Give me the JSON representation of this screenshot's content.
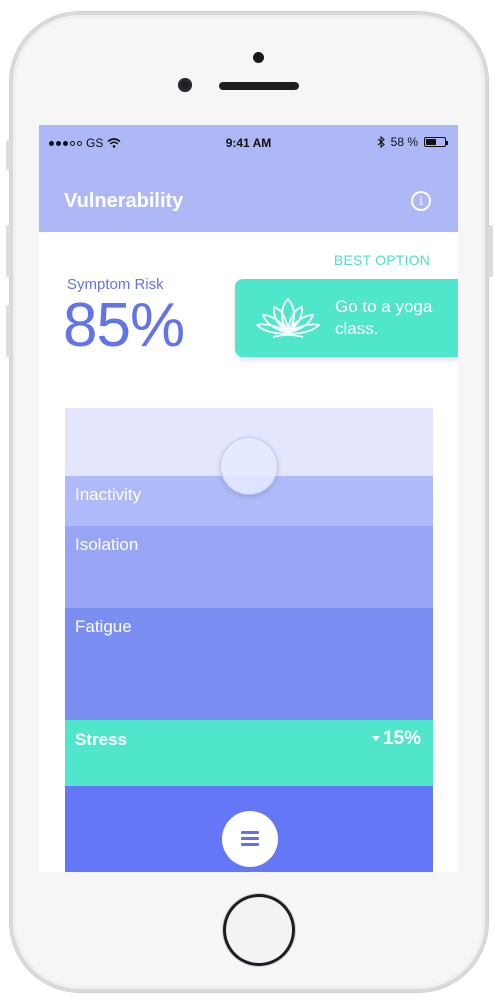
{
  "status_bar": {
    "carrier": "GS",
    "time": "9:41 AM",
    "battery": "58 %",
    "battery_level": 0.58
  },
  "header": {
    "title": "Vulnerability",
    "info_icon": "info-icon"
  },
  "best_option": {
    "label": "BEST OPTION",
    "text": "Go to a yoga class.",
    "icon": "lotus-icon"
  },
  "risk": {
    "label": "Symptom Risk",
    "value": "85%"
  },
  "factors": [
    {
      "label": "Inactivity",
      "color": "#afbaf8"
    },
    {
      "label": "Isolation",
      "color": "#98a5f4"
    },
    {
      "label": "Fatigue",
      "color": "#7b8ef1"
    },
    {
      "label": "Stress",
      "change": "15%",
      "color": "#4fe6cb"
    }
  ],
  "colors": {
    "accent": "#6274e8",
    "teal": "#4fe6cb",
    "header": "#aeb8f6"
  },
  "menu_icon": "menu-icon"
}
